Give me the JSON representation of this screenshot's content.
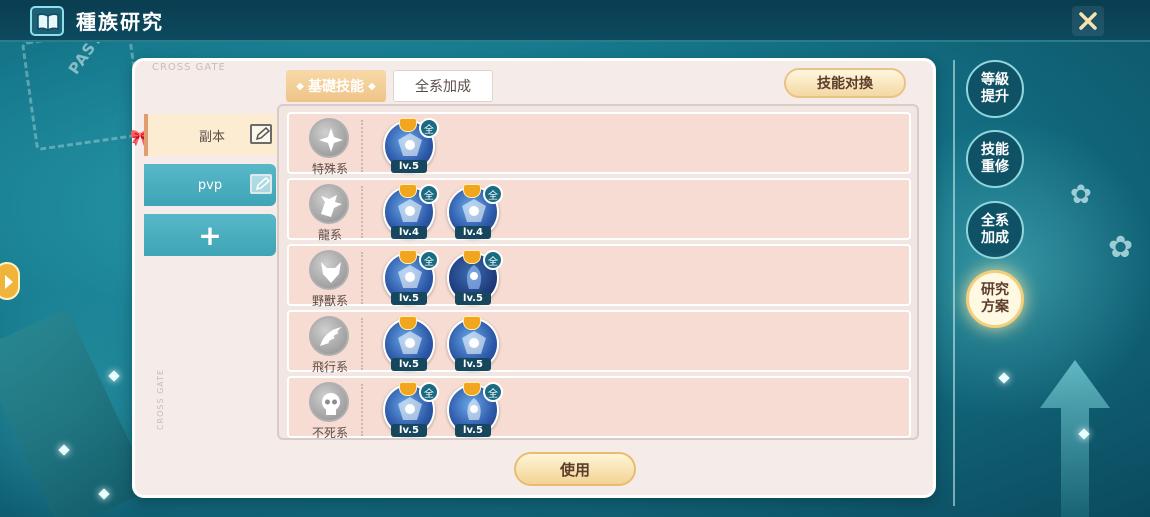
{
  "header": {
    "title": "種族研究"
  },
  "background": {
    "stamp_text": "PASTE"
  },
  "panel": {
    "brand": "CROSS GATE",
    "side_text": "CROSS GATE"
  },
  "tabs": [
    {
      "label": "基礎技能",
      "active": true
    },
    {
      "label": "全系加成",
      "active": false
    }
  ],
  "swap_button": {
    "label": "技能对換"
  },
  "plans": [
    {
      "label": "副本",
      "active": true
    },
    {
      "label": "pvp",
      "active": false
    },
    {
      "label": "+"
    }
  ],
  "rows": [
    {
      "category": "特殊系",
      "icon": "star-emblem-icon",
      "skills": [
        {
          "level": "lv.5",
          "badge": "全"
        }
      ]
    },
    {
      "category": "龍系",
      "icon": "dragon-icon",
      "skills": [
        {
          "level": "lv.4",
          "badge": "全"
        },
        {
          "level": "lv.4",
          "badge": "全"
        }
      ]
    },
    {
      "category": "野獸系",
      "icon": "beast-icon",
      "skills": [
        {
          "level": "lv.5",
          "badge": "全"
        },
        {
          "level": "lv.5",
          "badge": "全"
        }
      ]
    },
    {
      "category": "飛行系",
      "icon": "wing-icon",
      "skills": [
        {
          "level": "lv.5",
          "badge": ""
        },
        {
          "level": "lv.5",
          "badge": ""
        }
      ]
    },
    {
      "category": "不死系",
      "icon": "skull-icon",
      "skills": [
        {
          "level": "lv.5",
          "badge": "全"
        },
        {
          "level": "lv.5",
          "badge": "全"
        }
      ]
    }
  ],
  "use_button": {
    "label": "使用"
  },
  "side_nav": [
    {
      "label": "等級\n提升"
    },
    {
      "label": "技能\n重修"
    },
    {
      "label": "全系\n加成"
    },
    {
      "label": "研究\n方案",
      "active": true
    }
  ],
  "colors": {
    "accent": "#f3cf79",
    "teal": "#3ea4b6",
    "panel": "#f5ecea"
  }
}
